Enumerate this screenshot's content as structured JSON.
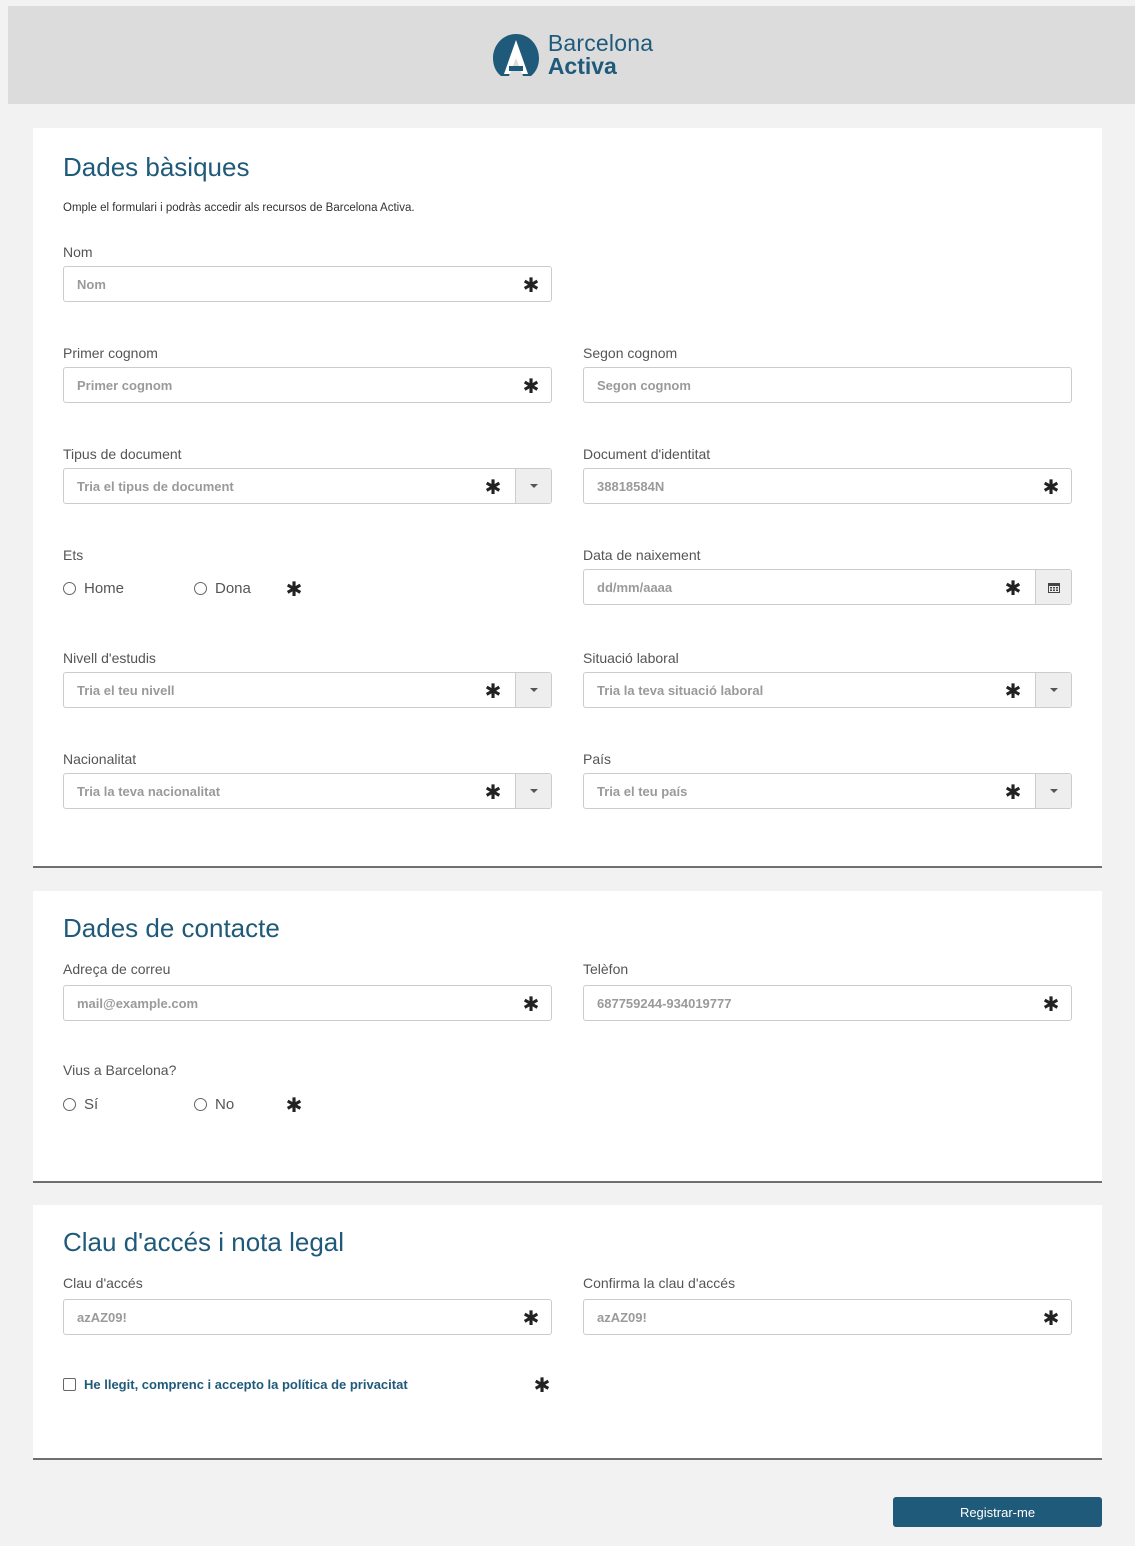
{
  "brand": {
    "line1": "Barcelona",
    "line2": "Activa",
    "color": "#1f5a7a"
  },
  "basic": {
    "title": "Dades bàsiques",
    "subtitle": "Omple el formulari i podràs accedir als recursos de Barcelona Activa.",
    "nom": {
      "label": "Nom",
      "placeholder": "Nom"
    },
    "primer_cognom": {
      "label": "Primer cognom",
      "placeholder": "Primer cognom"
    },
    "segon_cognom": {
      "label": "Segon cognom",
      "placeholder": "Segon cognom"
    },
    "tipus_document": {
      "label": "Tipus de document",
      "placeholder": "Tria el tipus de document"
    },
    "document": {
      "label": "Document d'identitat",
      "placeholder": "38818584N"
    },
    "ets": {
      "label": "Ets",
      "options": [
        "Home",
        "Dona"
      ]
    },
    "data_naixement": {
      "label": "Data de naixement",
      "placeholder": "dd/mm/aaaa"
    },
    "nivell_estudis": {
      "label": "Nivell d'estudis",
      "placeholder": "Tria el teu nivell"
    },
    "situacio_laboral": {
      "label": "Situació laboral",
      "placeholder": "Tria la teva situació laboral"
    },
    "nacionalitat": {
      "label": "Nacionalitat",
      "placeholder": "Tria la teva nacionalitat"
    },
    "pais": {
      "label": "País",
      "placeholder": "Tria el teu país"
    }
  },
  "contact": {
    "title": "Dades de contacte",
    "email": {
      "label": "Adreça de correu",
      "placeholder": "mail@example.com"
    },
    "telefon": {
      "label": "Telèfon",
      "placeholder": "687759244-934019777"
    },
    "barcelona": {
      "label": "Vius a Barcelona?",
      "options": [
        "Sí",
        "No"
      ]
    }
  },
  "legal": {
    "title": "Clau d'accés i nota legal",
    "clau": {
      "label": "Clau d'accés",
      "placeholder": "azAZ09!"
    },
    "confirma": {
      "label": "Confirma la clau d'accés",
      "placeholder": "azAZ09!"
    },
    "privacitat": "He llegit, comprenc i accepto la política de privacitat"
  },
  "required_mark": "✱",
  "submit_label": "Registrar-me"
}
